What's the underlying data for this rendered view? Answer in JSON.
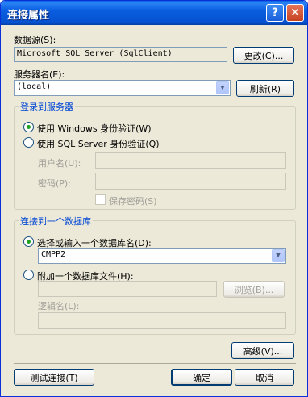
{
  "window": {
    "title": "连接属性",
    "help_glyph": "?",
    "close_glyph": "✕"
  },
  "datasource": {
    "label": "数据源(S):",
    "value": "Microsoft SQL Server (SqlClient)",
    "change_button": "更改(C)..."
  },
  "server": {
    "label": "服务器名(E):",
    "value": "(local)",
    "refresh_button": "刷新(R)"
  },
  "login_group": {
    "title": "登录到服务器",
    "windows_auth": "使用 Windows 身份验证(W)",
    "sql_auth": "使用 SQL Server 身份验证(Q)",
    "selected": "windows",
    "username_label": "用户名(U):",
    "username_value": "",
    "password_label": "密码(P):",
    "password_value": "",
    "save_password": "保存密码(S)"
  },
  "db_group": {
    "title": "连接到一个数据库",
    "select_db_option": "选择或输入一个数据库名(D):",
    "db_name": "CMPP2",
    "attach_option": "附加一个数据库文件(H):",
    "attach_value": "",
    "browse_button": "浏览(B)...",
    "logical_name_label": "逻辑名(L):",
    "logical_name_value": "",
    "selected": "select"
  },
  "buttons": {
    "advanced": "高级(V)...",
    "test": "测试连接(T)",
    "ok": "确定",
    "cancel": "取消"
  },
  "icons": {
    "dropdown": "▼"
  }
}
